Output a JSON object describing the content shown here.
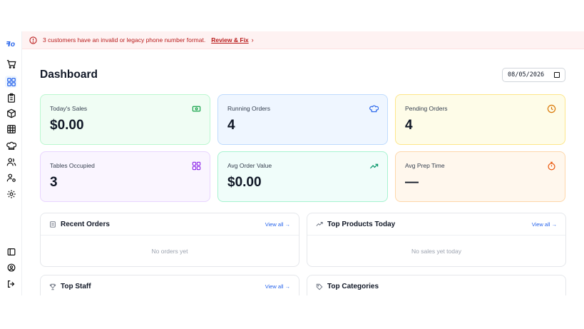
{
  "logo": "ꟻo",
  "banner": {
    "message": "3 customers have an invalid or legacy phone number format.",
    "fix_label": "Review & Fix",
    "chevron": "›",
    "color": "#b91c1c"
  },
  "sidebar": {
    "items": [
      {
        "icon": "cart-icon"
      },
      {
        "icon": "dashboard-grid-icon",
        "active": true
      },
      {
        "icon": "clipboard-icon"
      },
      {
        "icon": "box-icon"
      },
      {
        "icon": "table-grid-icon"
      },
      {
        "icon": "chef-hat-icon"
      },
      {
        "icon": "users-icon"
      },
      {
        "icon": "user-settings-icon"
      },
      {
        "icon": "settings-gear-icon"
      }
    ],
    "bottom": [
      {
        "icon": "sidebar-toggle-icon"
      },
      {
        "icon": "account-circle-icon"
      },
      {
        "icon": "logout-icon"
      }
    ]
  },
  "page": {
    "title": "Dashboard",
    "date_value": "08/05/2026"
  },
  "stats": [
    {
      "label": "Today's Sales",
      "value": "$0.00",
      "icon": "cash-icon",
      "color": "#16a34a"
    },
    {
      "label": "Running Orders",
      "value": "4",
      "icon": "chef-hat-icon",
      "color": "#2563eb"
    },
    {
      "label": "Pending Orders",
      "value": "4",
      "icon": "clock-icon",
      "color": "#d97706"
    },
    {
      "label": "Tables Occupied",
      "value": "3",
      "icon": "grid-icon",
      "color": "#9333ea"
    },
    {
      "label": "Avg Order Value",
      "value": "$0.00",
      "icon": "trending-up-icon",
      "color": "#059669"
    },
    {
      "label": "Avg Prep Time",
      "value": "—",
      "icon": "stopwatch-icon",
      "color": "#ea580c"
    }
  ],
  "panels": {
    "recent_orders": {
      "title": "Recent Orders",
      "view_all": "View all →",
      "empty": "No orders yet"
    },
    "top_products": {
      "title": "Top Products Today",
      "view_all": "View all →",
      "empty": "No sales yet today"
    },
    "top_staff": {
      "title": "Top Staff",
      "view_all": "View all →"
    },
    "top_categories": {
      "title": "Top Categories"
    }
  }
}
